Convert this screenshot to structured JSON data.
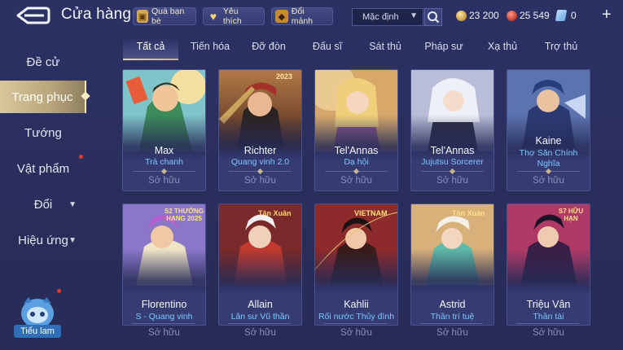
{
  "header": {
    "title": "Cửa hàng",
    "gift_label": "Quà bạn bè",
    "favorite_label": "Yêu thích",
    "exchange_label": "Đổi mảnh",
    "sort_value": "Mặc định",
    "gold": "23 200",
    "ruby": "25 549",
    "voucher": "0"
  },
  "sidebar": {
    "items": [
      {
        "label": "Đề cử"
      },
      {
        "label": "Trang phục"
      },
      {
        "label": "Tướng"
      },
      {
        "label": "Vật phẩm"
      },
      {
        "label": "Đổi"
      },
      {
        "label": "Hiệu ứng"
      }
    ],
    "assistant_label": "Tiểu lam"
  },
  "tabs": [
    {
      "label": "Tất cả"
    },
    {
      "label": "Tiến hóa"
    },
    {
      "label": "Đỡ đòn"
    },
    {
      "label": "Đấu sĩ"
    },
    {
      "label": "Sát thủ"
    },
    {
      "label": "Pháp sư"
    },
    {
      "label": "Xạ thủ"
    },
    {
      "label": "Trợ thủ"
    }
  ],
  "cards": [
    {
      "hero": "Max",
      "skin": "Trà chanh",
      "status": "Sở hữu",
      "badge": ""
    },
    {
      "hero": "Richter",
      "skin": "Quang vinh 2.0",
      "status": "Sở hữu",
      "badge": "2023"
    },
    {
      "hero": "Tel'Annas",
      "skin": "Dạ hội",
      "status": "Sở hữu",
      "badge": ""
    },
    {
      "hero": "Tel'Annas",
      "skin": "Jujutsu Sorcerer",
      "status": "Sở hữu",
      "badge": ""
    },
    {
      "hero": "Kaine",
      "skin": "Thợ Săn Chính Nghĩa",
      "status": "Sở hữu",
      "badge": ""
    },
    {
      "hero": "Florentino",
      "skin": "S - Quang vinh",
      "status": "Sở hữu",
      "badge": "S2 THƯỞNG HẠNG 2025"
    },
    {
      "hero": "Allain",
      "skin": "Lân sư Vũ thần",
      "status": "Sở hữu",
      "badge": "Tân Xuân"
    },
    {
      "hero": "Kahlii",
      "skin": "Rối nước Thủy đình",
      "status": "Sở hữu",
      "badge": "VIETNAM"
    },
    {
      "hero": "Astrid",
      "skin": "Thần trí tuệ",
      "status": "Sở hữu",
      "badge": "Tân Xuân"
    },
    {
      "hero": "Triệu Vân",
      "skin": "Thần tài",
      "status": "Sở hữu",
      "badge": "S7 HỮU HẠN"
    }
  ],
  "colors": {
    "background": "#2a2f5e",
    "accent_gold": "#d9c79d",
    "skin_name_blue": "#7cc7ff",
    "owned_gray": "#8a8fb9"
  },
  "icons": [
    "back-arrow-icon",
    "gift-icon",
    "heart-icon",
    "shard-icon",
    "search-icon",
    "gold-coin-icon",
    "ruby-icon",
    "voucher-icon",
    "plus-icon"
  ]
}
